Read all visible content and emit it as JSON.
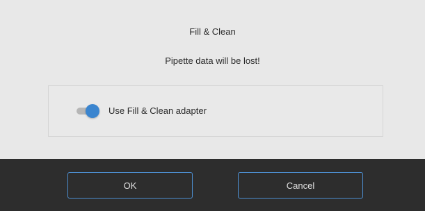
{
  "dialog": {
    "title": "Fill & Clean",
    "message": "Pipette data will be lost!",
    "option": {
      "label": "Use Fill & Clean adapter",
      "toggle_on": true
    },
    "buttons": {
      "ok_label": "OK",
      "cancel_label": "Cancel"
    }
  },
  "colors": {
    "background": "#e8e8e8",
    "footer": "#2d2d2d",
    "accent": "#3b85cf",
    "button_border": "#4d8fd1"
  },
  "icons": {
    "toggle": "toggle-switch-icon"
  }
}
